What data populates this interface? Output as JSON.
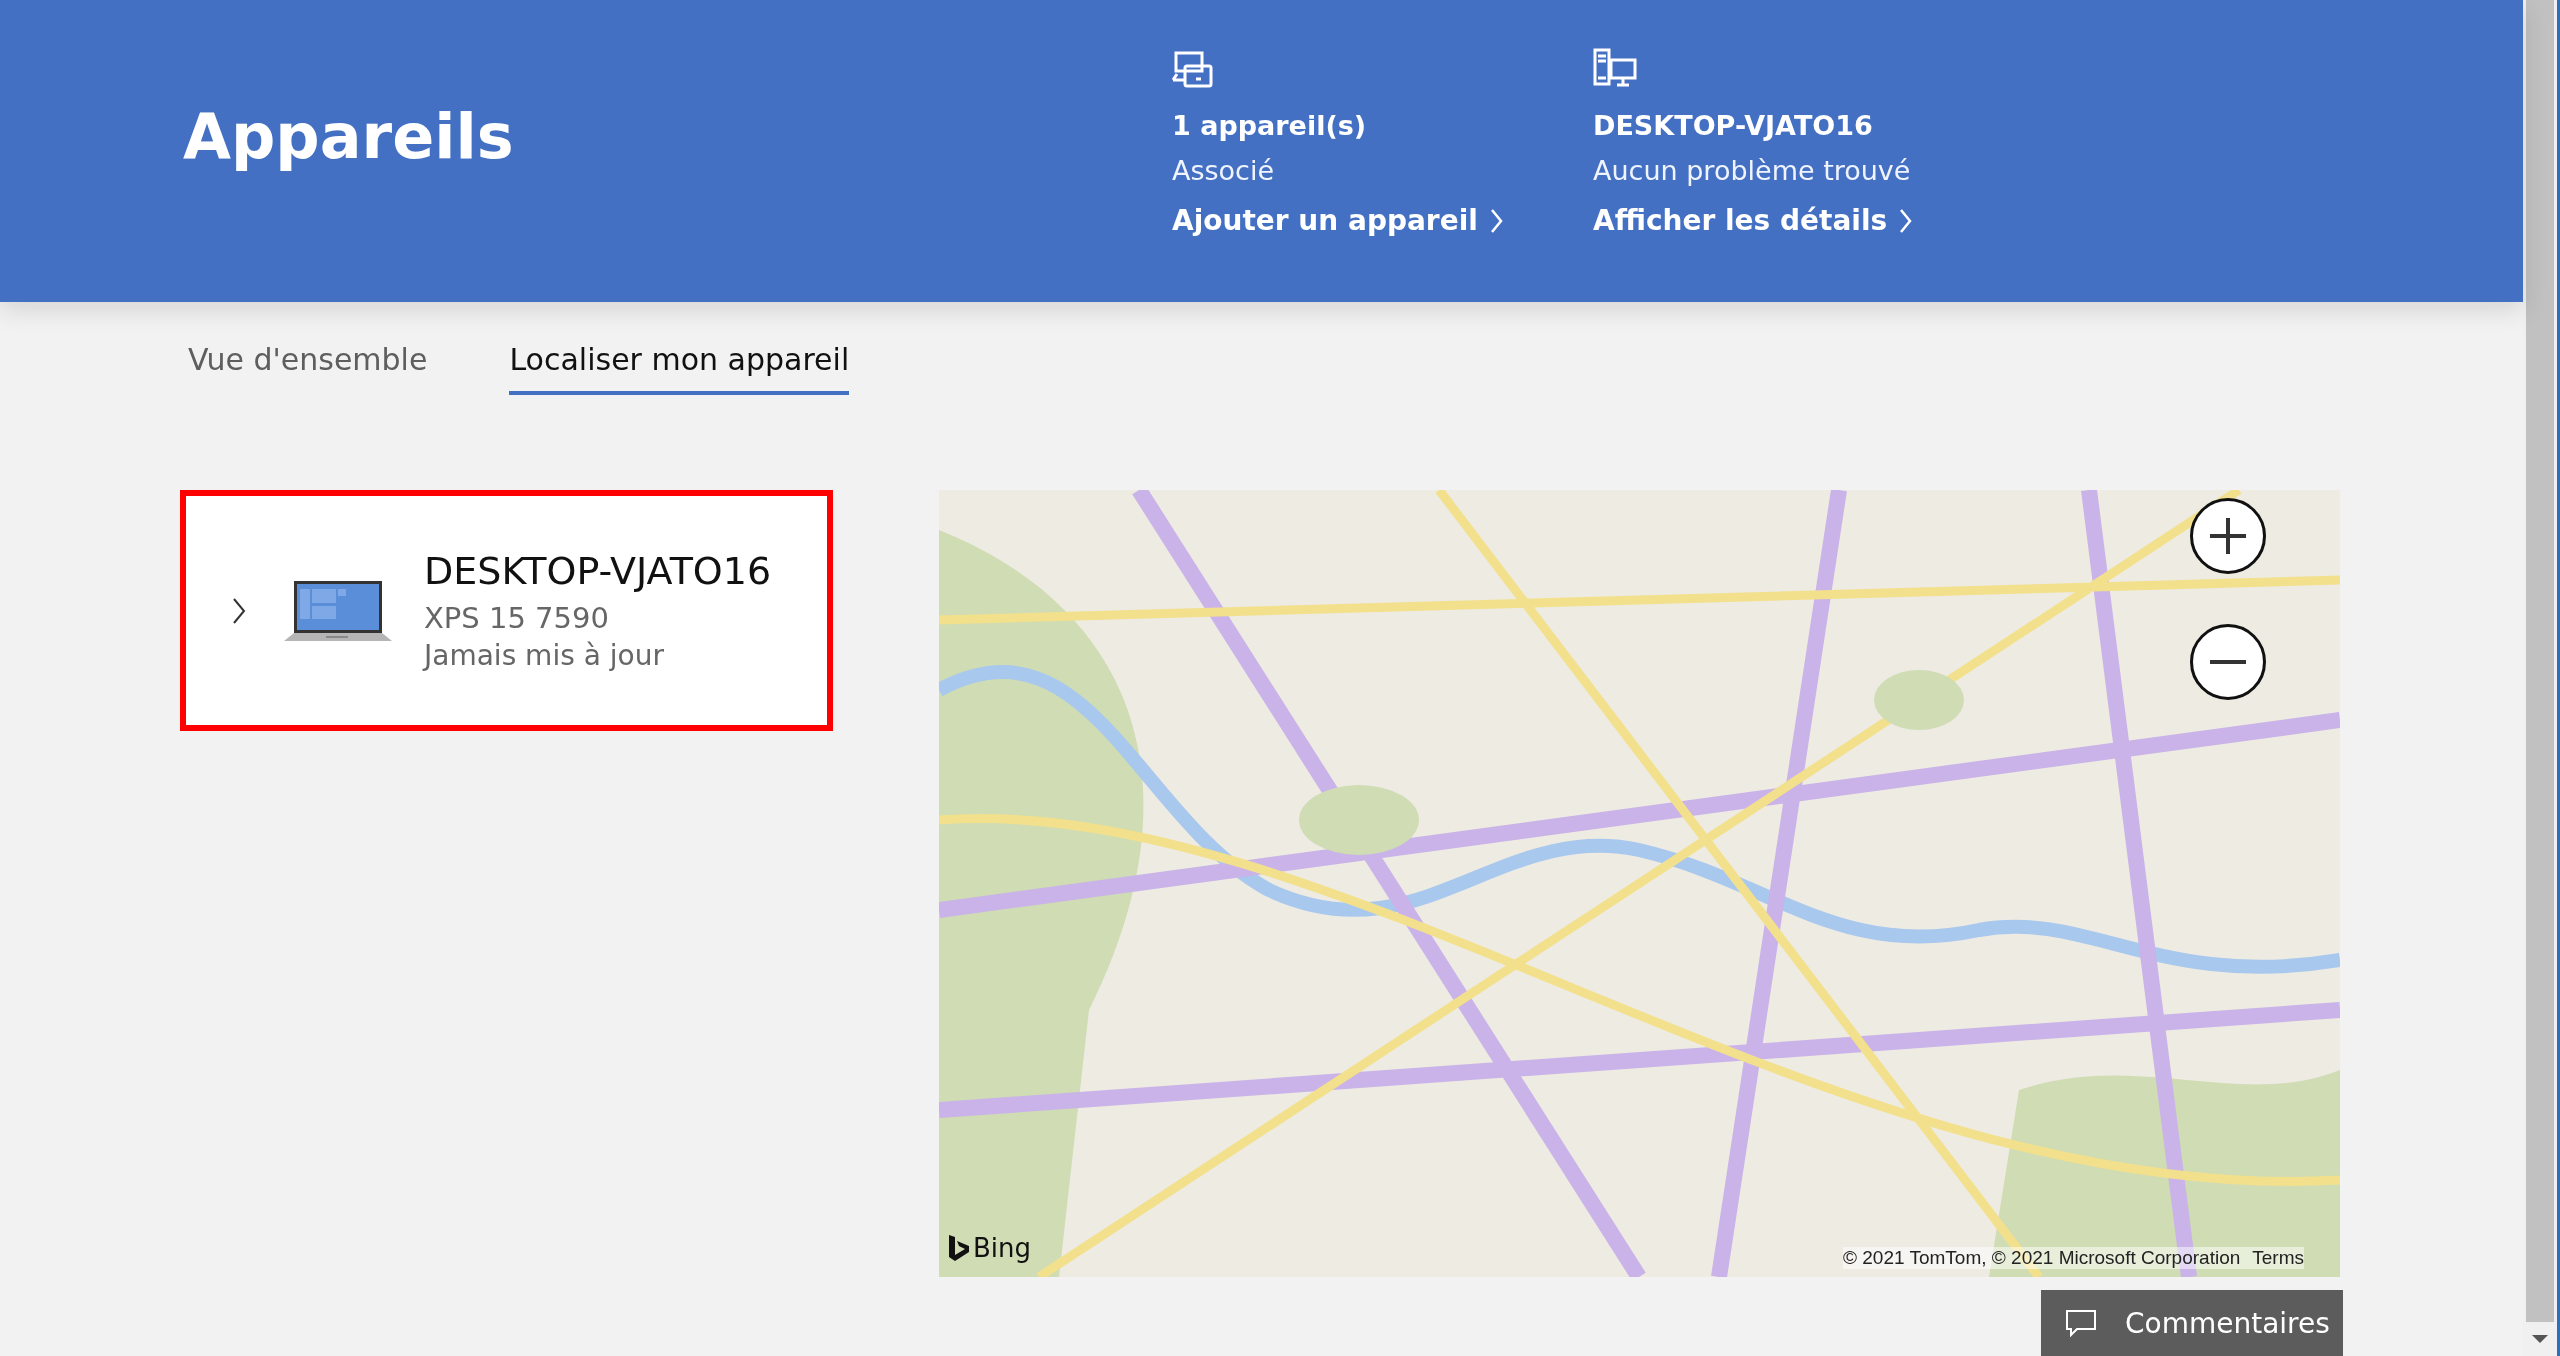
{
  "header": {
    "title": "Appareils",
    "stats": [
      {
        "kind": "devices",
        "value": "1 appareil(s)",
        "caption": "Associé",
        "link": "Ajouter un appareil"
      },
      {
        "kind": "computer",
        "value": "DESKTOP-VJATO16",
        "caption": "Aucun problème trouvé",
        "link": "Afficher les détails"
      }
    ]
  },
  "tabs": [
    {
      "label": "Vue d'ensemble",
      "selected": false
    },
    {
      "label": "Localiser mon appareil",
      "selected": true
    }
  ],
  "devices": [
    {
      "name": "DESKTOP-VJATO16",
      "model": "XPS 15 7590",
      "status": "Jamais mis à jour",
      "expanded": false,
      "highlighted": true
    }
  ],
  "map": {
    "kind": "picture",
    "logo": "Bing",
    "attribution": "© 2021 TomTom, © 2021 Microsoft Corporation",
    "terms": "Terms"
  },
  "feedback_button": "Commentaires"
}
